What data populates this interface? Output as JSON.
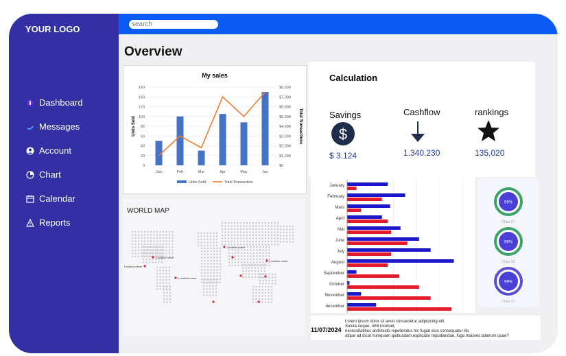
{
  "logo": "YOUR LOGO",
  "search": {
    "placeholder": "search"
  },
  "page_title": "Overview",
  "nav": [
    {
      "label": "Dashboard",
      "icon": "dashboard-icon"
    },
    {
      "label": "Messages",
      "icon": "messages-icon"
    },
    {
      "label": "Account",
      "icon": "account-icon"
    },
    {
      "label": "Chart",
      "icon": "pie-chart-icon"
    },
    {
      "label": "Calendar",
      "icon": "calendar-icon"
    },
    {
      "label": "Reports",
      "icon": "warning-icon"
    }
  ],
  "calculation": {
    "title": "Calculation",
    "items": [
      {
        "label": "Savings",
        "value": "$ 3.124",
        "icon": "dollar-icon"
      },
      {
        "label": "Cashflow",
        "value": "1.340.230",
        "icon": "arrow-down-icon"
      },
      {
        "label": "rankings",
        "value": "135,020",
        "icon": "star-icon"
      }
    ]
  },
  "map": {
    "title": "WORLD MAP",
    "location_label": "Location name"
  },
  "footer": {
    "date": "11/07/2024",
    "text": [
      "Lorem ipsum dolor sit amet consectetur adipisicing elit.",
      "Soluta neque, nihil incidunt,",
      "necessitatibus architecto repellendus hic fugiat eius consequatur illo",
      "atque ad dicat numquam quibusdam explicabo repudiandae, fuga maiores laborum quae?"
    ]
  },
  "gauges": [
    {
      "value_label": "99%",
      "caption": "Chart 01",
      "color": "#3aa36c"
    },
    {
      "value_label": "98%",
      "caption": "Chart 02",
      "color": "#3aa36c"
    },
    {
      "value_label": "99%",
      "caption": "Chart 03",
      "color": "#5a4fd0"
    }
  ],
  "colors": {
    "sidebar": "#3330a6",
    "topbar": "#0a5cf5",
    "bar_blue": "#4472c4",
    "line_orange": "#ed7d31",
    "hbar_blue": "#1a16c9",
    "hbar_red": "#e41b2a"
  },
  "chart_data": [
    {
      "type": "bar",
      "title": "My sales",
      "categories": [
        "Jan",
        "Feb",
        "Mar",
        "Apr",
        "May",
        "Jun"
      ],
      "series": [
        {
          "name": "Units Sold",
          "type": "bar",
          "axis": "left",
          "values": [
            50,
            100,
            30,
            105,
            88,
            150
          ]
        },
        {
          "name": "Total Transaction",
          "type": "line",
          "axis": "right",
          "values": [
            1000,
            3000,
            1800,
            7000,
            5000,
            7500
          ]
        }
      ],
      "ylabel": "Units Sold",
      "y2label": "Total Transactions",
      "ylim": [
        0,
        160
      ],
      "y2lim": [
        0,
        8000
      ],
      "yticks": [
        "0",
        "20",
        "40",
        "60",
        "80",
        "100",
        "120",
        "140",
        "160"
      ],
      "y2ticks": [
        "$0",
        "$1,000",
        "$2,000",
        "$3,000",
        "$4,000",
        "$5,000",
        "$6,000",
        "$7,000",
        "$8,000"
      ],
      "legend": "bottom"
    },
    {
      "type": "bar",
      "orientation": "horizontal",
      "categories": [
        "January",
        "February",
        "Mars",
        "April",
        "Mai",
        "June",
        "July",
        "August",
        "September",
        "October",
        "November",
        "december"
      ],
      "series": [
        {
          "values": [
            35,
            50,
            37,
            30,
            46,
            62,
            72,
            92,
            8,
            2,
            12,
            25
          ]
        },
        {
          "values": [
            8,
            30,
            12,
            35,
            38,
            52,
            38,
            35,
            45,
            62,
            72,
            90
          ]
        }
      ],
      "xlim": [
        0,
        100
      ],
      "grid": true
    }
  ]
}
